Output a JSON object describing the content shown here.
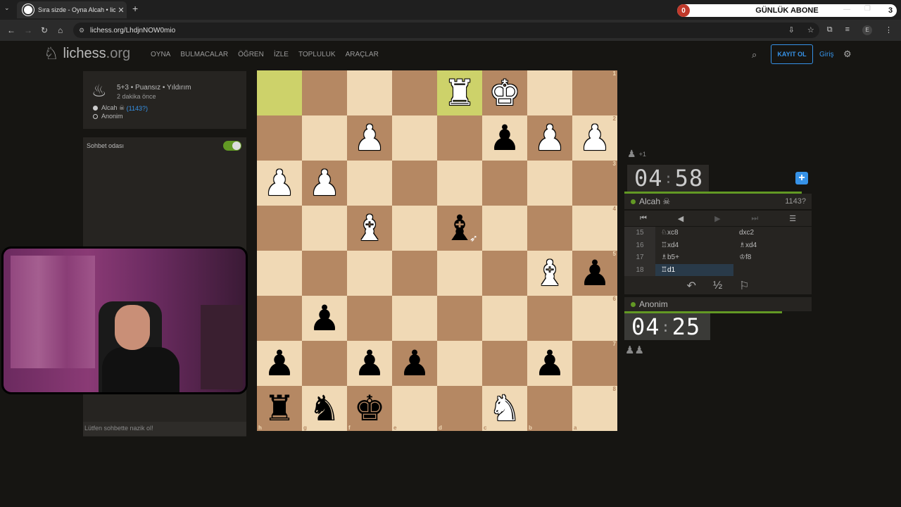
{
  "browser": {
    "tab_title": "Sıra sizde - Oyna Alcah • liches",
    "tab_close": "✕",
    "new_tab": "+",
    "tab_menu": "⌄",
    "url": "lichess.org/LhdjnNOW0mio",
    "profile_initial": "E"
  },
  "subscribe_widget": {
    "count": "0",
    "label": "GÜNLÜK ABONE",
    "goal": "3"
  },
  "site": {
    "logo_name": "lichess",
    "logo_tld": ".org",
    "nav": [
      "OYNA",
      "BULMACALAR",
      "ÖĞREN",
      "İZLE",
      "TOPLULUK",
      "ARAÇLAR"
    ],
    "signup_label": "KAYIT OL",
    "login_label": "Giriş"
  },
  "game_info": {
    "type": "5+3 • Puansız • Yıldırım",
    "ago": "2 dakika önce",
    "white_player": "Alcah ☠",
    "white_rating": "(1143?)",
    "black_player": "Anonim"
  },
  "chat": {
    "title": "Sohbet odası",
    "placeholder": "Lütfen sohbette nazik ol!"
  },
  "board": {
    "orientation": "black",
    "rows": [
      [
        "",
        "",
        "",
        "",
        "♜",
        "♚",
        "",
        ""
      ],
      [
        "",
        "",
        "♟",
        "",
        "",
        "♟b",
        "♟",
        "♟"
      ],
      [
        "♟",
        "♟",
        "",
        "",
        "",
        "",
        "",
        ""
      ],
      [
        "",
        "",
        "♝",
        "",
        "♝b",
        "",
        "",
        ""
      ],
      [
        "",
        "",
        "",
        "",
        "",
        "",
        "♝",
        "♟b"
      ],
      [
        "",
        "♟b",
        "",
        "",
        "",
        "",
        "",
        ""
      ],
      [
        "♟b",
        "",
        "♟b",
        "♟b",
        "",
        "",
        "♟b",
        ""
      ],
      [
        "♜b",
        "♞b",
        "♚b",
        "",
        "",
        "♞",
        "",
        ""
      ]
    ],
    "highlights": [
      [
        0,
        0
      ],
      [
        0,
        4
      ]
    ],
    "rank_labels": [
      "1",
      "2",
      "3",
      "4",
      "5",
      "6",
      "7",
      "8"
    ],
    "file_labels": [
      "h",
      "g",
      "f",
      "e",
      "d",
      "c",
      "b",
      "a"
    ]
  },
  "right_panel": {
    "captured_top_extra": "+1",
    "top_clock": {
      "min": "04",
      "sec": "58"
    },
    "top_player": {
      "name": "Alcah ☠",
      "rating": "1143?"
    },
    "bottom_clock": {
      "min": "04",
      "sec": "25"
    },
    "bottom_player": {
      "name": "Anonim"
    },
    "moves": [
      {
        "num": "15",
        "white": "♘xc8",
        "black": "dxc2"
      },
      {
        "num": "16",
        "white": "♖xd4",
        "black": "♗xd4"
      },
      {
        "num": "17",
        "white": "♗b5+",
        "black": "♔f8"
      },
      {
        "num": "18",
        "white": "♖d1",
        "black": ""
      }
    ],
    "draw_label": "½"
  },
  "colors": {
    "light_square": "#f0d9b5",
    "dark_square": "#b58863",
    "highlight": "#cdd26a",
    "accent_blue": "#3692e7",
    "online_green": "#629924"
  }
}
